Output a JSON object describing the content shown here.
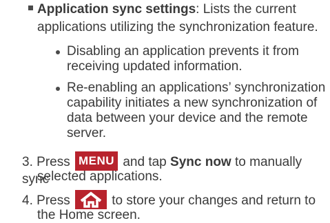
{
  "settings_item": {
    "title": "Application sync settings",
    "desc_line1": ": Lists the current",
    "desc_line2": "applications utilizing the synchronization feature."
  },
  "sub_items": [
    {
      "line1": "Disabling an application prevents it from",
      "line2": "receiving updated information."
    },
    {
      "line1": "Re-enabling an applications’ synchronization",
      "line2": "capability initiates a new synchronization of",
      "line3": "data between your device and the remote",
      "line4": "server."
    }
  ],
  "steps": [
    {
      "number": "3.",
      "before_key": "Press",
      "key_label": "MENU",
      "mid": "and tap",
      "bold": "Sync now",
      "after": "to manually sync",
      "line2": "selected applications."
    },
    {
      "number": "4.",
      "before_key": "Press",
      "key_icon": "home-icon",
      "after": "to store your changes and return to",
      "line2": "the Home screen."
    }
  ],
  "colors": {
    "key_background": "#b8232d",
    "text": "#3a3a3a"
  }
}
